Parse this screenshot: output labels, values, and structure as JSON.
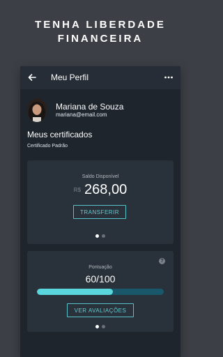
{
  "promo": {
    "line1": "TENHA LIBERDADE",
    "line2": "FINANCEIRA"
  },
  "appbar": {
    "title": "Meu Perfil",
    "back_icon": "arrow-left-icon",
    "menu_icon": "more-horizontal-icon"
  },
  "profile": {
    "name": "Mariana de Souza",
    "email": "mariana@email.com"
  },
  "certificates": {
    "title": "Meus certificados",
    "selected": "Certificado Padrão"
  },
  "balance_card": {
    "label": "Saldo Disponível",
    "currency": "R$",
    "value": "268,00",
    "button": "TRANSFERIR",
    "page_index": 0,
    "page_count": 2
  },
  "score_card": {
    "label": "Pontuação",
    "value": "60/100",
    "progress": 0.6,
    "button": "VER AVALIAÇÕES",
    "help_icon": "help-circle-icon",
    "page_index": 0,
    "page_count": 2
  },
  "colors": {
    "background": "#3c4046",
    "surface": "#1e252d",
    "card": "#29313a",
    "accent": "#5ad7dd",
    "progress_track": "#18586a"
  }
}
